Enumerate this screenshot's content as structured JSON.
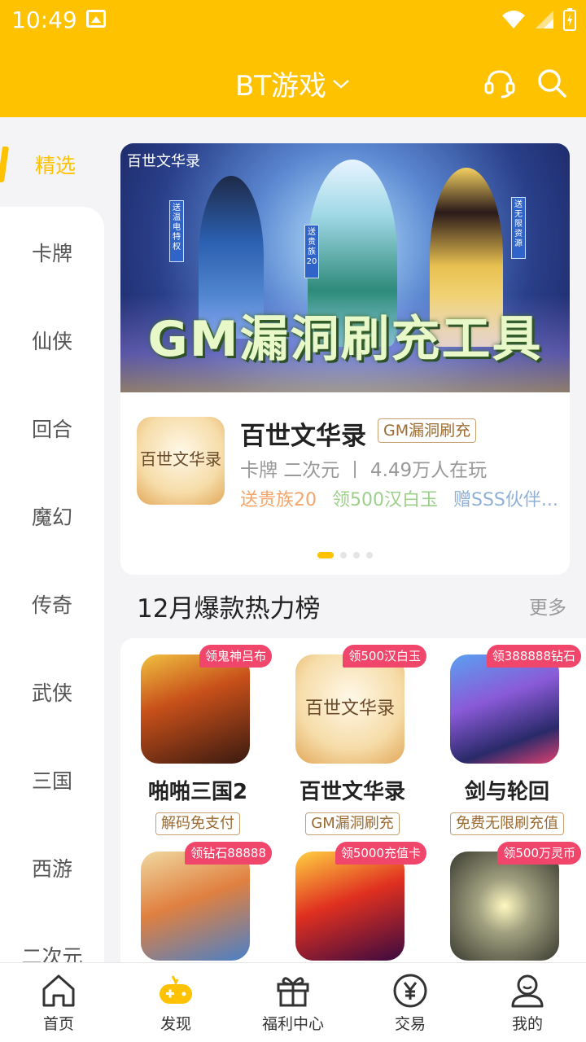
{
  "status": {
    "time": "10:49"
  },
  "header": {
    "title": "BT游戏"
  },
  "sidebar": {
    "selected": "精选",
    "items": [
      "卡牌",
      "仙侠",
      "回合",
      "魔幻",
      "传奇",
      "武侠",
      "三国",
      "西游",
      "二次元"
    ]
  },
  "banner": {
    "headline": "GM漏洞刷充工具",
    "logo": "百世文华录",
    "tags": [
      "送温电特权",
      "送贵族20",
      "送无限资源"
    ],
    "game": {
      "name": "百世文华录",
      "tag": "GM漏洞刷充",
      "icon_text": "百世文华录",
      "meta": "卡牌 二次元 丨 4.49万人在玩",
      "perks": [
        {
          "text": "送贵族20",
          "color": "#f5a56a"
        },
        {
          "text": "领500汉白玉",
          "color": "#9ccf8a"
        },
        {
          "text": "赠SSS伙伴...",
          "color": "#8fb0d8"
        }
      ]
    }
  },
  "section": {
    "title": "12月爆款热力榜",
    "more": "更多"
  },
  "games": [
    {
      "badge": "领鬼神吕布",
      "name": "啪啪三国2",
      "feature": "解码免支付"
    },
    {
      "badge": "领500汉白玉",
      "name": "百世文华录",
      "feature": "GM漏洞刷充",
      "icon_text": "百世文华录"
    },
    {
      "badge": "领388888钻石",
      "name": "剑与轮回",
      "feature": "免费无限刷充值"
    },
    {
      "badge": "领钻石88888",
      "name": "",
      "feature": ""
    },
    {
      "badge": "领5000充值卡",
      "name": "",
      "feature": ""
    },
    {
      "badge": "领500万灵币",
      "name": "",
      "feature": ""
    }
  ],
  "nav": [
    {
      "label": "首页",
      "icon": "home-icon"
    },
    {
      "label": "发现",
      "icon": "gamepad-icon"
    },
    {
      "label": "福利中心",
      "icon": "gift-icon"
    },
    {
      "label": "交易",
      "icon": "yen-icon"
    },
    {
      "label": "我的",
      "icon": "user-icon"
    }
  ],
  "colors": {
    "accent": "#fec200",
    "badge": "#f1466b"
  }
}
